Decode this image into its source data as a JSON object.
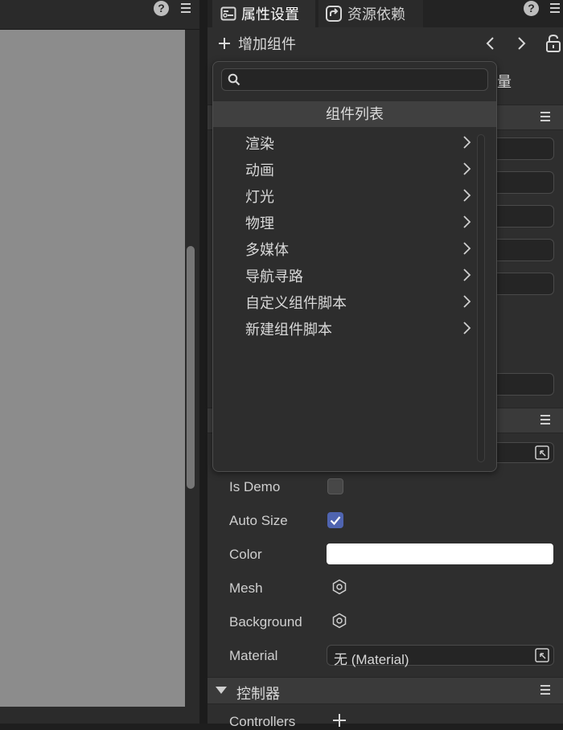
{
  "left_panel": {
    "help_glyph": "?"
  },
  "tabs": [
    {
      "label": "属性设置"
    },
    {
      "label": "资源依赖"
    }
  ],
  "toolbar": {
    "add_component_label": "增加组件"
  },
  "partial_label": "量",
  "component_dropdown": {
    "search": {
      "value": "",
      "placeholder": ""
    },
    "header": "组件列表",
    "items": [
      {
        "label": "渲染"
      },
      {
        "label": "动画"
      },
      {
        "label": "灯光"
      },
      {
        "label": "物理"
      },
      {
        "label": "多媒体"
      },
      {
        "label": "导航寻路"
      },
      {
        "label": "自定义组件脚本"
      },
      {
        "label": "新建组件脚本"
      }
    ]
  },
  "properties": {
    "is_demo": {
      "label": "Is Demo",
      "checked": false
    },
    "auto_size": {
      "label": "Auto Size",
      "checked": true
    },
    "color": {
      "label": "Color",
      "value": "#ffffff"
    },
    "mesh": {
      "label": "Mesh"
    },
    "background": {
      "label": "Background"
    },
    "material": {
      "label": "Material",
      "value": "无 (Material)"
    }
  },
  "controller_section": {
    "title": "控制器",
    "controllers_label": "Controllers"
  },
  "colors": {
    "accent_checkbox": "#4f64b0",
    "viewport": "#8c8c8c",
    "panel": "#2e2e2e"
  }
}
